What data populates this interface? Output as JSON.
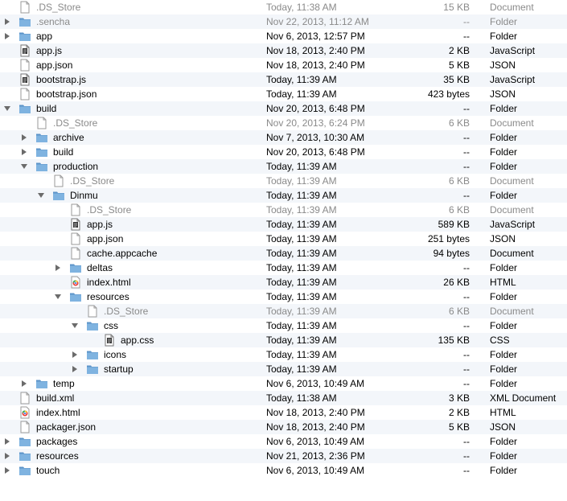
{
  "rows": [
    {
      "name": ".DS_Store",
      "date": "Today, 11:38 AM",
      "size": "15 KB",
      "kind": "Document",
      "level": 0,
      "icon": "blank-file-icon",
      "dim": true
    },
    {
      "name": ".sencha",
      "date": "Nov 22, 2013, 11:12 AM",
      "size": "--",
      "kind": "Folder",
      "level": 0,
      "icon": "folder-icon",
      "toggle": "collapsed",
      "dim": true
    },
    {
      "name": "app",
      "date": "Nov 6, 2013, 12:57 PM",
      "size": "--",
      "kind": "Folder",
      "level": 0,
      "icon": "folder-icon",
      "toggle": "collapsed"
    },
    {
      "name": "app.js",
      "date": "Nov 18, 2013, 2:40 PM",
      "size": "2 KB",
      "kind": "JavaScript",
      "level": 0,
      "icon": "script-file-icon"
    },
    {
      "name": "app.json",
      "date": "Nov 18, 2013, 2:40 PM",
      "size": "5 KB",
      "kind": "JSON",
      "level": 0,
      "icon": "blank-file-icon"
    },
    {
      "name": "bootstrap.js",
      "date": "Today, 11:39 AM",
      "size": "35 KB",
      "kind": "JavaScript",
      "level": 0,
      "icon": "script-file-icon"
    },
    {
      "name": "bootstrap.json",
      "date": "Today, 11:39 AM",
      "size": "423 bytes",
      "kind": "JSON",
      "level": 0,
      "icon": "blank-file-icon"
    },
    {
      "name": "build",
      "date": "Nov 20, 2013, 6:48 PM",
      "size": "--",
      "kind": "Folder",
      "level": 0,
      "icon": "folder-icon",
      "toggle": "expanded"
    },
    {
      "name": ".DS_Store",
      "date": "Nov 20, 2013, 6:24 PM",
      "size": "6 KB",
      "kind": "Document",
      "level": 1,
      "icon": "blank-file-icon",
      "dim": true
    },
    {
      "name": "archive",
      "date": "Nov 7, 2013, 10:30 AM",
      "size": "--",
      "kind": "Folder",
      "level": 1,
      "icon": "folder-icon",
      "toggle": "collapsed"
    },
    {
      "name": "build",
      "date": "Nov 20, 2013, 6:48 PM",
      "size": "--",
      "kind": "Folder",
      "level": 1,
      "icon": "folder-icon",
      "toggle": "collapsed"
    },
    {
      "name": "production",
      "date": "Today, 11:39 AM",
      "size": "--",
      "kind": "Folder",
      "level": 1,
      "icon": "folder-icon",
      "toggle": "expanded"
    },
    {
      "name": ".DS_Store",
      "date": "Today, 11:39 AM",
      "size": "6 KB",
      "kind": "Document",
      "level": 2,
      "icon": "blank-file-icon",
      "dim": true
    },
    {
      "name": "Dinmu",
      "date": "Today, 11:39 AM",
      "size": "--",
      "kind": "Folder",
      "level": 2,
      "icon": "folder-icon",
      "toggle": "expanded"
    },
    {
      "name": ".DS_Store",
      "date": "Today, 11:39 AM",
      "size": "6 KB",
      "kind": "Document",
      "level": 3,
      "icon": "blank-file-icon",
      "dim": true
    },
    {
      "name": "app.js",
      "date": "Today, 11:39 AM",
      "size": "589 KB",
      "kind": "JavaScript",
      "level": 3,
      "icon": "script-file-icon"
    },
    {
      "name": "app.json",
      "date": "Today, 11:39 AM",
      "size": "251 bytes",
      "kind": "JSON",
      "level": 3,
      "icon": "blank-file-icon"
    },
    {
      "name": "cache.appcache",
      "date": "Today, 11:39 AM",
      "size": "94 bytes",
      "kind": "Document",
      "level": 3,
      "icon": "blank-file-icon"
    },
    {
      "name": "deltas",
      "date": "Today, 11:39 AM",
      "size": "--",
      "kind": "Folder",
      "level": 3,
      "icon": "folder-icon",
      "toggle": "collapsed"
    },
    {
      "name": "index.html",
      "date": "Today, 11:39 AM",
      "size": "26 KB",
      "kind": "HTML",
      "level": 3,
      "icon": "html-file-icon"
    },
    {
      "name": "resources",
      "date": "Today, 11:39 AM",
      "size": "--",
      "kind": "Folder",
      "level": 3,
      "icon": "folder-icon",
      "toggle": "expanded"
    },
    {
      "name": ".DS_Store",
      "date": "Today, 11:39 AM",
      "size": "6 KB",
      "kind": "Document",
      "level": 4,
      "icon": "blank-file-icon",
      "dim": true
    },
    {
      "name": "css",
      "date": "Today, 11:39 AM",
      "size": "--",
      "kind": "Folder",
      "level": 4,
      "icon": "folder-icon",
      "toggle": "expanded"
    },
    {
      "name": "app.css",
      "date": "Today, 11:39 AM",
      "size": "135 KB",
      "kind": "CSS",
      "level": 5,
      "icon": "script-file-icon"
    },
    {
      "name": "icons",
      "date": "Today, 11:39 AM",
      "size": "--",
      "kind": "Folder",
      "level": 4,
      "icon": "folder-icon",
      "toggle": "collapsed"
    },
    {
      "name": "startup",
      "date": "Today, 11:39 AM",
      "size": "--",
      "kind": "Folder",
      "level": 4,
      "icon": "folder-icon",
      "toggle": "collapsed"
    },
    {
      "name": "temp",
      "date": "Nov 6, 2013, 10:49 AM",
      "size": "--",
      "kind": "Folder",
      "level": 1,
      "icon": "folder-icon",
      "toggle": "collapsed"
    },
    {
      "name": "build.xml",
      "date": "Today, 11:38 AM",
      "size": "3 KB",
      "kind": "XML Document",
      "level": 0,
      "icon": "blank-file-icon"
    },
    {
      "name": "index.html",
      "date": "Nov 18, 2013, 2:40 PM",
      "size": "2 KB",
      "kind": "HTML",
      "level": 0,
      "icon": "html-file-icon"
    },
    {
      "name": "packager.json",
      "date": "Nov 18, 2013, 2:40 PM",
      "size": "5 KB",
      "kind": "JSON",
      "level": 0,
      "icon": "blank-file-icon"
    },
    {
      "name": "packages",
      "date": "Nov 6, 2013, 10:49 AM",
      "size": "--",
      "kind": "Folder",
      "level": 0,
      "icon": "folder-icon",
      "toggle": "collapsed"
    },
    {
      "name": "resources",
      "date": "Nov 21, 2013, 2:36 PM",
      "size": "--",
      "kind": "Folder",
      "level": 0,
      "icon": "folder-icon",
      "toggle": "collapsed"
    },
    {
      "name": "touch",
      "date": "Nov 6, 2013, 10:49 AM",
      "size": "--",
      "kind": "Folder",
      "level": 0,
      "icon": "folder-icon",
      "toggle": "collapsed"
    }
  ],
  "colors": {
    "folder": "#7fb3e0",
    "folder_dark": "#5b93c8",
    "triangle": "#6b6b6b",
    "alt_row": "#f3f6fa",
    "dim_text": "#8a8a8a"
  }
}
